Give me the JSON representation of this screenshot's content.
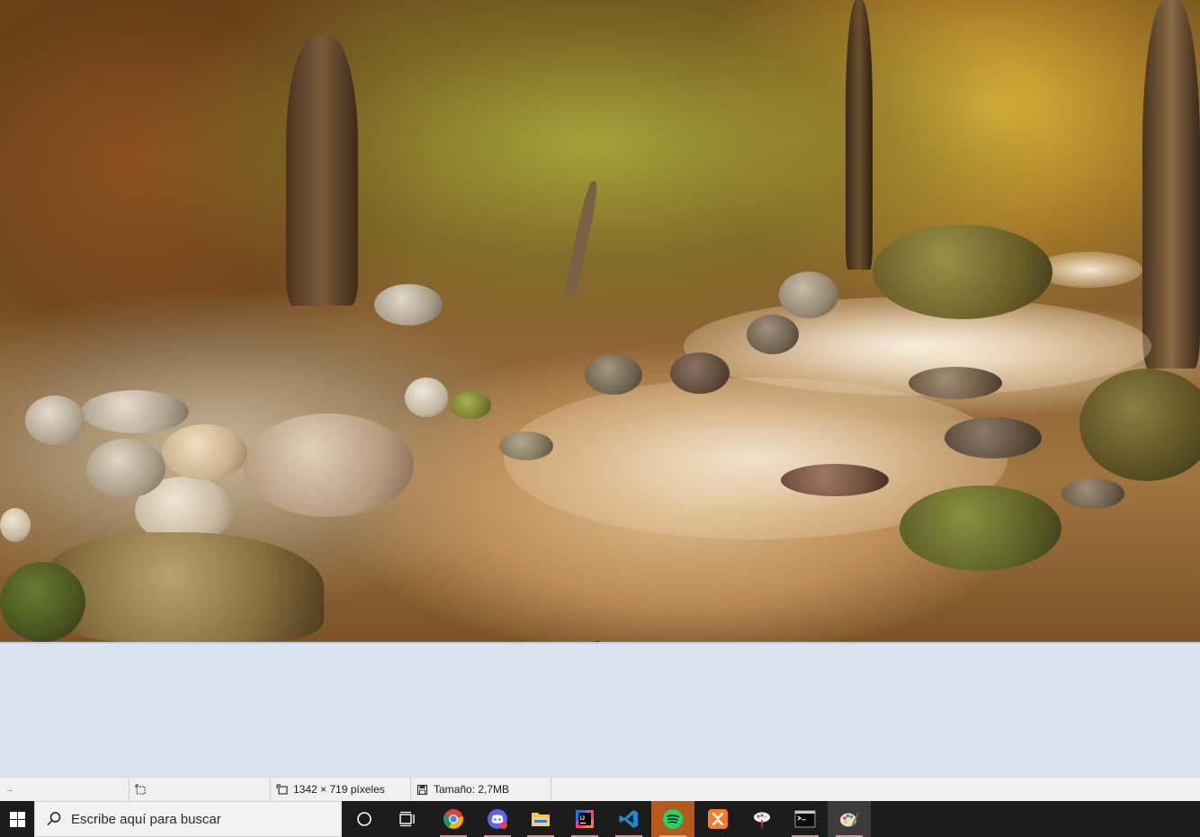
{
  "status_bar": {
    "selection_text": "",
    "dimensions_text": "1342 × 719 píxeles",
    "size_text": "Tamaño: 2,7MB"
  },
  "taskbar": {
    "search_placeholder": "Escribe aquí para buscar",
    "apps": [
      {
        "name": "chrome",
        "icon": "chrome-icon"
      },
      {
        "name": "discord",
        "icon": "discord-icon",
        "badge": "1"
      },
      {
        "name": "file-explorer",
        "icon": "folder-icon"
      },
      {
        "name": "intellij",
        "icon": "intellij-icon"
      },
      {
        "name": "vscode",
        "icon": "vscode-icon"
      },
      {
        "name": "spotify",
        "icon": "spotify-icon"
      },
      {
        "name": "xampp",
        "icon": "xampp-icon"
      },
      {
        "name": "paint-3d",
        "icon": "paint3d-icon"
      },
      {
        "name": "terminal",
        "icon": "terminal-icon"
      },
      {
        "name": "paint",
        "icon": "paint-icon"
      }
    ]
  },
  "colors": {
    "workspace_bg": "#dae3f0",
    "statusbar_bg": "#f0f0f0",
    "taskbar_bg": "#1b1b1b",
    "spotify_highlight": "#b35b1e"
  }
}
